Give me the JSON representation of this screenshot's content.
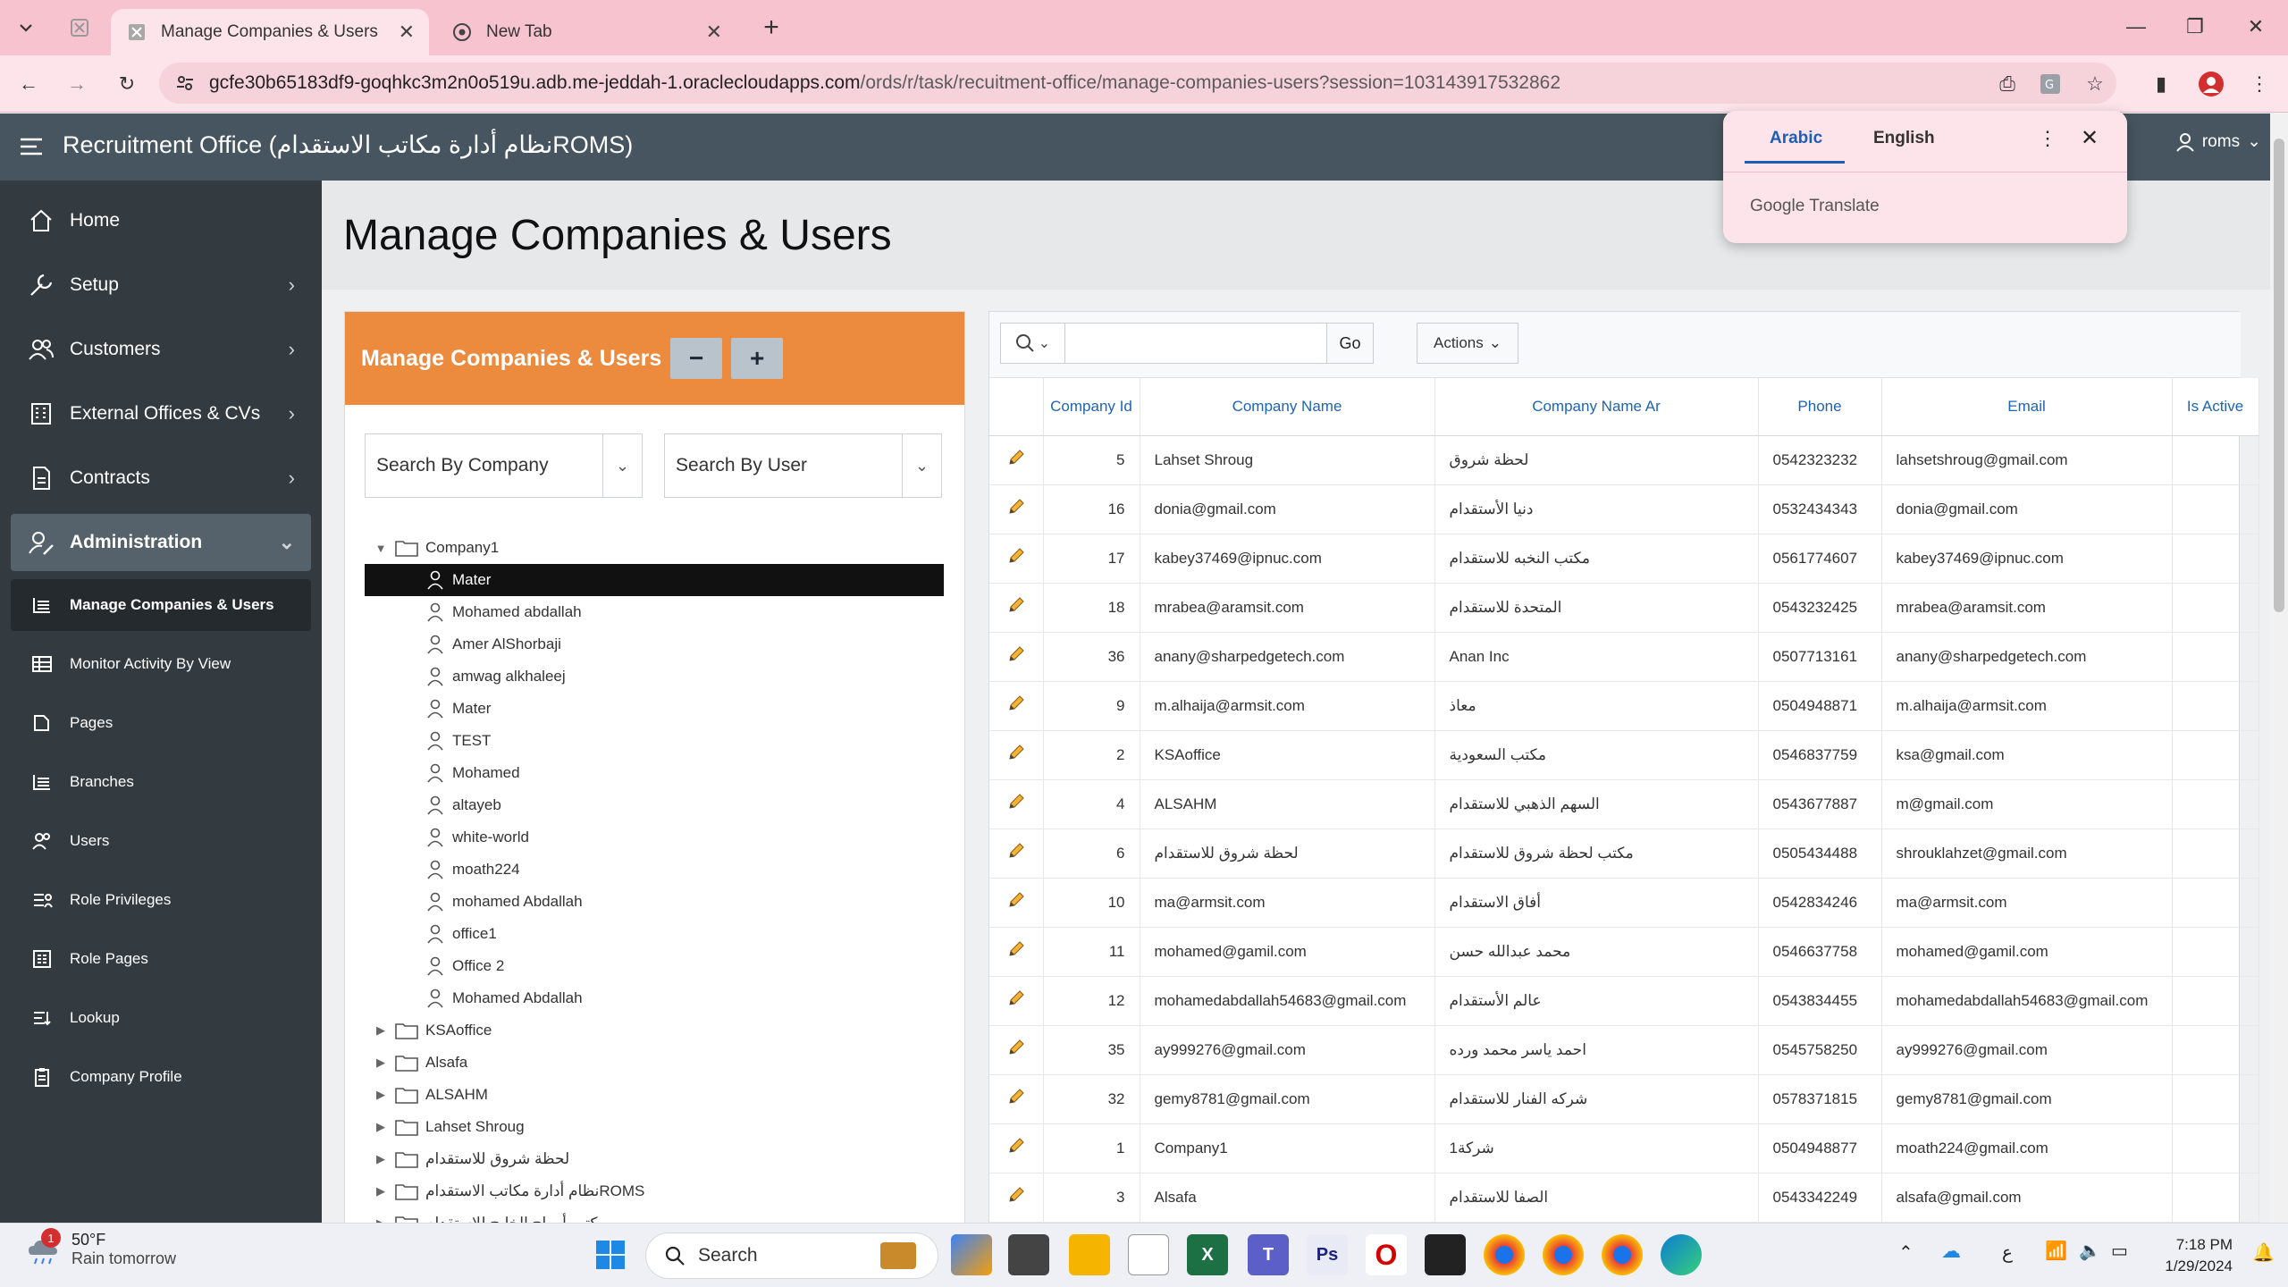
{
  "browser": {
    "tabs": [
      {
        "label": "Manage Companies & Users",
        "active": true
      },
      {
        "label": "New Tab",
        "active": false
      }
    ],
    "url_host": "gcfe30b65183df9-goqhkc3m2n0o519u.adb.me-jeddah-1.oraclecloudapps.com",
    "url_path": "/ords/r/task/recuitment-office/manage-companies-users?session=103143917532862"
  },
  "app": {
    "title": "Recruitment Office (نظام أدارة مكاتب الاستقدامROMS)",
    "user": "roms"
  },
  "translate_popup": {
    "lang_from": "Arabic",
    "lang_to": "English",
    "brand": "Google Translate"
  },
  "sidebar": {
    "items": [
      {
        "label": "Home",
        "icon": "home-icon",
        "has_children": false
      },
      {
        "label": "Setup",
        "icon": "wrench-icon",
        "has_children": true
      },
      {
        "label": "Customers",
        "icon": "users-icon",
        "has_children": true
      },
      {
        "label": "External Offices & CVs",
        "icon": "building-icon",
        "has_children": true
      },
      {
        "label": "Contracts",
        "icon": "contract-icon",
        "has_children": true
      },
      {
        "label": "Administration",
        "icon": "admin-icon",
        "has_children": true,
        "expanded": true
      }
    ],
    "sub_items": [
      {
        "label": "Manage Companies & Users",
        "icon": "list-icon",
        "current": true
      },
      {
        "label": "Monitor Activity By View",
        "icon": "table-icon"
      },
      {
        "label": "Pages",
        "icon": "pages-icon"
      },
      {
        "label": "Branches",
        "icon": "list-icon"
      },
      {
        "label": "Users",
        "icon": "users-icon"
      },
      {
        "label": "Role Privileges",
        "icon": "role-icon"
      },
      {
        "label": "Role Pages",
        "icon": "role-pages-icon"
      },
      {
        "label": "Lookup",
        "icon": "lookup-icon"
      },
      {
        "label": "Company Profile",
        "icon": "clipboard-icon"
      }
    ]
  },
  "page": {
    "title": "Manage Companies & Users"
  },
  "left_region": {
    "title": "Manage Companies & Users",
    "collapse_label": "−",
    "expand_label": "+",
    "search_company_placeholder": "Search By Company",
    "search_user_placeholder": "Search By User",
    "tree": {
      "root": "Company1",
      "users": [
        "Mater",
        "Mohamed abdallah",
        "Amer AlShorbaji",
        "amwag alkhaleej",
        "Mater",
        "TEST",
        "Mohamed",
        "altayeb",
        "white-world",
        "moath224",
        "mohamed Abdallah",
        "office1",
        "Office 2",
        "Mohamed Abdallah"
      ],
      "selected_user_index": 0,
      "other_companies": [
        "KSAoffice",
        "Alsafa",
        "ALSAHM",
        "Lahset Shroug",
        "لحظة شروق للاستقدام",
        "نظام أدارة مكاتب الاستقدامROMS",
        "مكتب أمواج الخليج للاستقدام"
      ]
    }
  },
  "grid": {
    "go_label": "Go",
    "actions_label": "Actions",
    "columns": [
      "",
      "Company Id",
      "Company Name",
      "Company Name Ar",
      "Phone",
      "Email",
      "Is Active"
    ],
    "rows": [
      [
        "5",
        "Lahset Shroug",
        "لحظة شروق",
        "0542323232",
        "lahsetshroug@gmail.com",
        ""
      ],
      [
        "16",
        "donia@gmail.com",
        "دنيا الأستقدام",
        "0532434343",
        "donia@gmail.com",
        ""
      ],
      [
        "17",
        "kabey37469@ipnuc.com",
        "مكتب النخبه للاستقدام",
        "0561774607",
        "kabey37469@ipnuc.com",
        ""
      ],
      [
        "18",
        "mrabea@aramsit.com",
        "المتحدة للاستقدام",
        "0543232425",
        "mrabea@aramsit.com",
        ""
      ],
      [
        "36",
        "anany@sharpedgetech.com",
        "Anan Inc",
        "0507713161",
        "anany@sharpedgetech.com",
        ""
      ],
      [
        "9",
        "m.alhaija@armsit.com",
        "معاذ",
        "0504948871",
        "m.alhaija@armsit.com",
        ""
      ],
      [
        "2",
        "KSAoffice",
        "مكتب السعودية",
        "0546837759",
        "ksa@gmail.com",
        ""
      ],
      [
        "4",
        "ALSAHM",
        "السهم الذهبي للاستقدام",
        "0543677887",
        "m@gmail.com",
        ""
      ],
      [
        "6",
        "لحظة شروق للاستقدام",
        "مكتب لحظة شروق للاستقدام",
        "0505434488",
        "shrouklahzet@gmail.com",
        ""
      ],
      [
        "10",
        "ma@armsit.com",
        "أفاق الاستقدام",
        "0542834246",
        "ma@armsit.com",
        ""
      ],
      [
        "11",
        "mohamed@gamil.com",
        "محمد عبدالله حسن",
        "0546637758",
        "mohamed@gamil.com",
        ""
      ],
      [
        "12",
        "mohamedabdallah54683@gmail.com",
        "عالم الأستقدام",
        "0543834455",
        "mohamedabdallah54683@gmail.com",
        ""
      ],
      [
        "35",
        "ay999276@gmail.com",
        "احمد ياسر محمد ورده",
        "0545758250",
        "ay999276@gmail.com",
        ""
      ],
      [
        "32",
        "gemy8781@gmail.com",
        "شركه الفنار للاستقدام",
        "0578371815",
        "gemy8781@gmail.com",
        ""
      ],
      [
        "1",
        "Company1",
        "شركة1",
        "0504948877",
        "moath224@gmail.com",
        ""
      ],
      [
        "3",
        "Alsafa",
        "الصفا للاستقدام",
        "0543342249",
        "alsafa@gmail.com",
        ""
      ]
    ]
  },
  "taskbar": {
    "weather_temp": "50°F",
    "weather_text": "Rain tomorrow",
    "weather_badge": "1",
    "search_label": "Search",
    "time": "7:18 PM",
    "date": "1/29/2024",
    "lang_indicator": "ع"
  },
  "colors": {
    "header": "#46555f",
    "sidebar": "#343b40",
    "region_header": "#ec8a3d",
    "link": "#1d64b3",
    "chrome": "#f7c3cf"
  }
}
